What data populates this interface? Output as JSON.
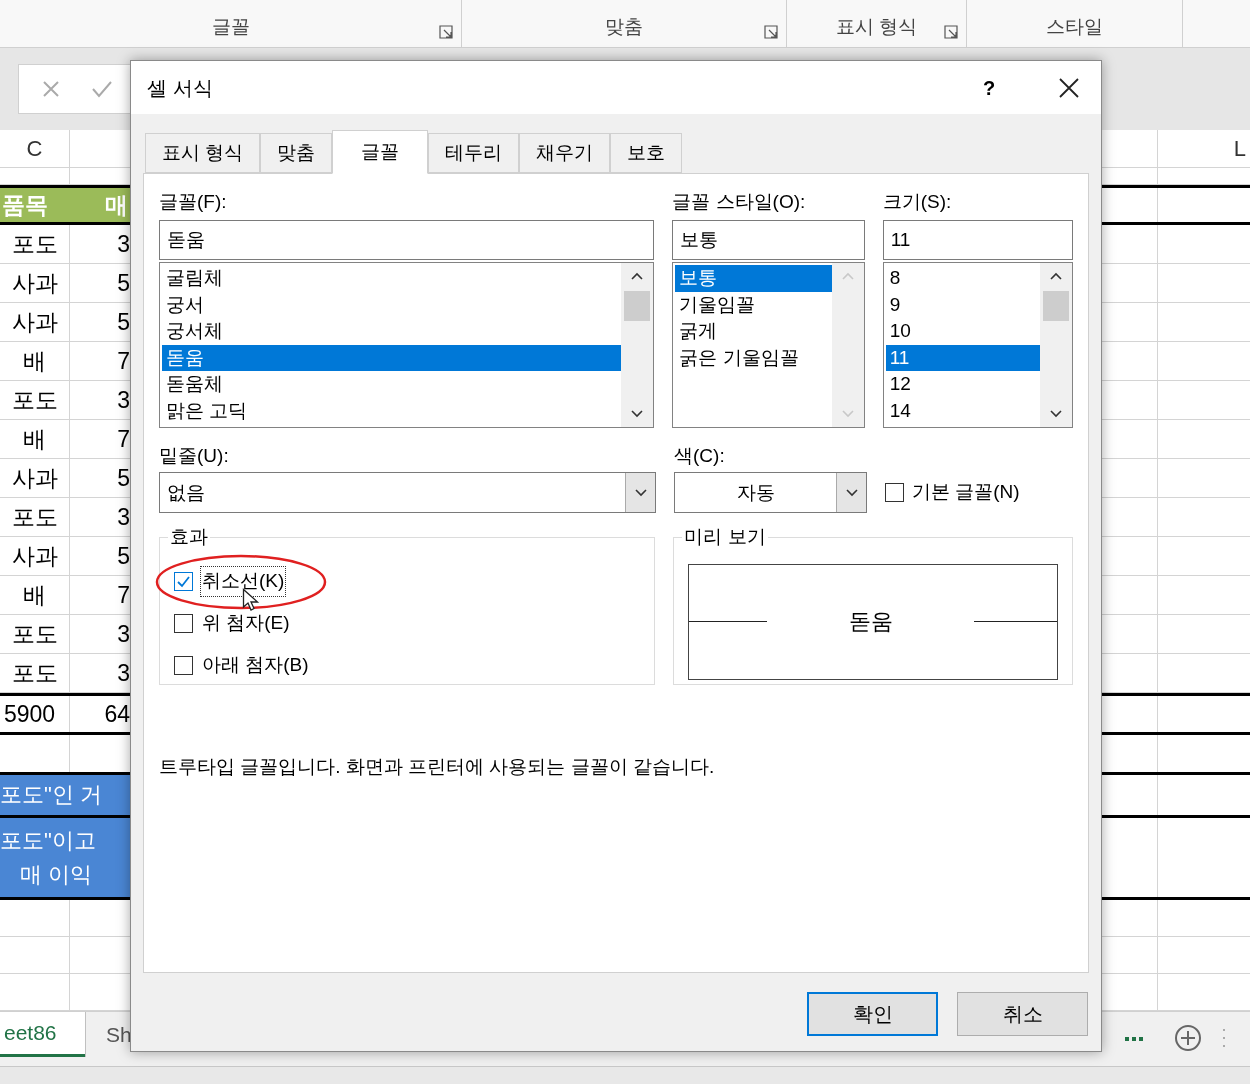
{
  "ribbon": {
    "groups": [
      {
        "label": "글꼴",
        "launcher": true
      },
      {
        "label": "맞춤",
        "launcher": true
      },
      {
        "label": "표시 형식",
        "launcher": true
      },
      {
        "label": "스타일",
        "launcher": false
      }
    ]
  },
  "sheet": {
    "columns": [
      "C",
      "L"
    ],
    "header": [
      "품목",
      "매"
    ],
    "rows": [
      [
        "포도",
        "3"
      ],
      [
        "사과",
        "5"
      ],
      [
        "사과",
        "5"
      ],
      [
        "배",
        "7"
      ],
      [
        "포도",
        "3"
      ],
      [
        "배",
        "7"
      ],
      [
        "사과",
        "5"
      ],
      [
        "포도",
        "3"
      ],
      [
        "사과",
        "5"
      ],
      [
        "배",
        "7"
      ],
      [
        "포도",
        "3"
      ],
      [
        "포도",
        "3"
      ]
    ],
    "total": [
      "5900",
      "64"
    ],
    "notes": [
      {
        "lines": [
          "포도\"인 거"
        ]
      },
      {
        "lines": [
          "포도\"이고",
          "매 이익"
        ]
      }
    ]
  },
  "sheet_tabs": [
    {
      "label": "eet86",
      "selected": true
    },
    {
      "label": "Sh",
      "selected": false
    }
  ],
  "dialog": {
    "title": "셀 서식",
    "help": "?",
    "tabs": [
      {
        "label": "표시 형식",
        "selected": false
      },
      {
        "label": "맞춤",
        "selected": false
      },
      {
        "label": "글꼴",
        "selected": true
      },
      {
        "label": "테두리",
        "selected": false
      },
      {
        "label": "채우기",
        "selected": false
      },
      {
        "label": "보호",
        "selected": false
      }
    ],
    "lists": [
      {
        "label": "글꼴(F):",
        "value": "돋움",
        "scrollable": true,
        "items": [
          {
            "label": "굴림체",
            "selected": false
          },
          {
            "label": "궁서",
            "selected": false
          },
          {
            "label": "궁서체",
            "selected": false
          },
          {
            "label": "돋움",
            "selected": true
          },
          {
            "label": "돋움체",
            "selected": false
          },
          {
            "label": "맑은 고딕",
            "selected": false
          }
        ]
      },
      {
        "label": "글꼴 스타일(O):",
        "value": "보통",
        "scrollable": false,
        "items": [
          {
            "label": "보통",
            "selected": true
          },
          {
            "label": "기울임꼴",
            "selected": false
          },
          {
            "label": "굵게",
            "selected": false
          },
          {
            "label": "굵은 기울임꼴",
            "selected": false
          }
        ]
      },
      {
        "label": "크기(S):",
        "value": "11",
        "scrollable": true,
        "items": [
          {
            "label": "8",
            "selected": false
          },
          {
            "label": "9",
            "selected": false
          },
          {
            "label": "10",
            "selected": false
          },
          {
            "label": "11",
            "selected": true
          },
          {
            "label": "12",
            "selected": false
          },
          {
            "label": "14",
            "selected": false
          }
        ]
      }
    ],
    "underline": {
      "label": "밑줄(U):",
      "value": "없음"
    },
    "color": {
      "label": "색(C):",
      "value": "자동"
    },
    "normal_font": {
      "label": "기본 글꼴(N)",
      "checked": false
    },
    "effects": {
      "label": "효과",
      "items": [
        {
          "label": "취소선(K)",
          "checked": true,
          "focused": true
        },
        {
          "label": "위 첨자(E)",
          "checked": false,
          "focused": false
        },
        {
          "label": "아래 첨자(B)",
          "checked": false,
          "focused": false
        }
      ]
    },
    "preview": {
      "label": "미리 보기",
      "text": "돋움"
    },
    "description": "트루타입 글꼴입니다. 화면과 프린터에 사용되는 글꼴이 같습니다.",
    "buttons": [
      {
        "label": "확인",
        "focused": true
      },
      {
        "label": "취소",
        "focused": false
      }
    ]
  }
}
